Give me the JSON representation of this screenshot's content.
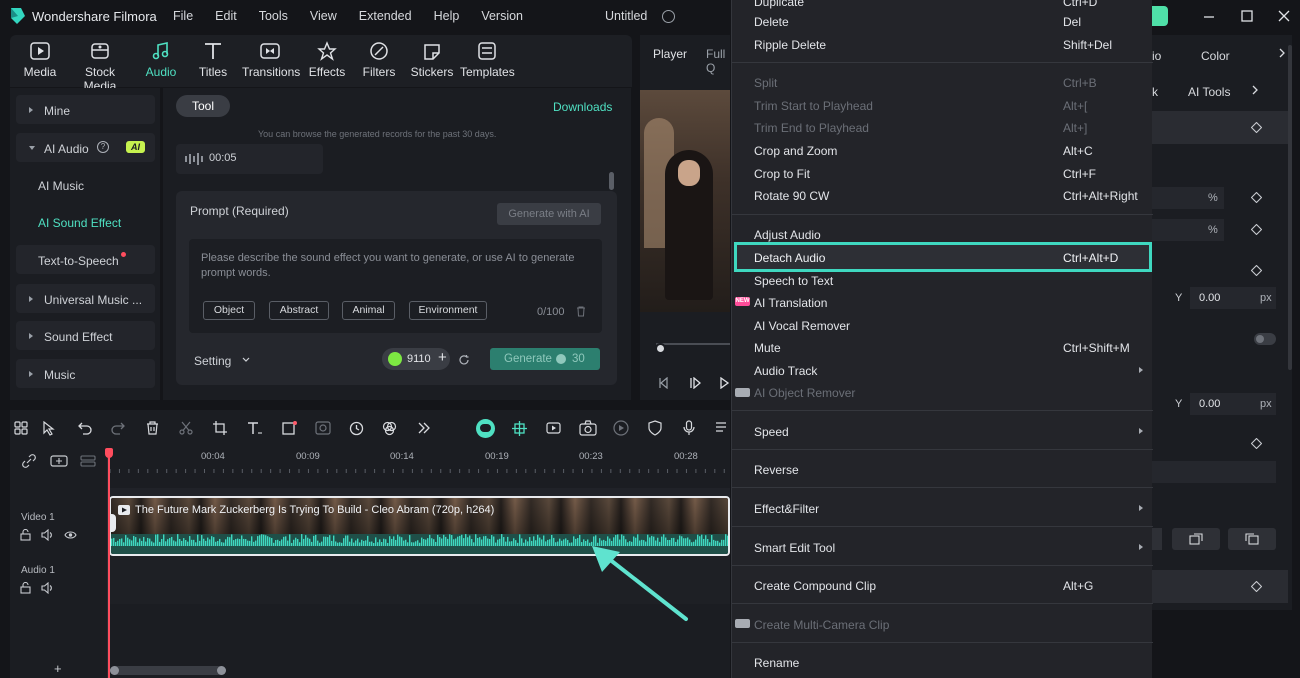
{
  "app": {
    "name": "Wondershare Filmora",
    "menu": [
      "File",
      "Edit",
      "Tools",
      "View",
      "Extended",
      "Help",
      "Version"
    ],
    "document_title": "Untitled"
  },
  "toolbar": {
    "tabs": [
      "Media",
      "Stock Media",
      "Audio",
      "Titles",
      "Transitions",
      "Effects",
      "Filters",
      "Stickers",
      "Templates"
    ]
  },
  "sidebar": {
    "mine": "Mine",
    "ai_audio": "AI Audio",
    "ai_badge": "AI",
    "ai_music": "AI Music",
    "ai_sound_effect": "AI Sound Effect",
    "tts": "Text-to-Speech",
    "universal_music": "Universal Music ...",
    "sound_effect": "Sound Effect",
    "music": "Music"
  },
  "ai_panel": {
    "tab": "Tool",
    "downloads": "Downloads",
    "records_note": "You can browse the generated records for the past 30 days.",
    "record_time": "00:05",
    "prompt_label": "Prompt (Required)",
    "generate_with_ai": "Generate with AI",
    "placeholder": "Please describe the sound effect you want to generate, or use AI to generate prompt words.",
    "chips": [
      "Object",
      "Abstract",
      "Animal",
      "Environment"
    ],
    "counter": "0/100",
    "setting": "Setting",
    "credits": "9110",
    "generate": "Generate",
    "generate_cost": "30"
  },
  "player": {
    "tab_player": "Player",
    "tab_full": "Full Q"
  },
  "timeline": {
    "ruler": [
      "00:04",
      "00:09",
      "00:14",
      "00:19",
      "00:23",
      "00:28"
    ],
    "video_track": "Video 1",
    "audio_track": "Audio 1",
    "clip_title": "The Future Mark Zuckerberg Is Trying To Build - Cleo Abram (720p, h264)"
  },
  "right_panel": {
    "tab_audio_partial": "io",
    "tab_color": "Color",
    "ai_tools": "AI Tools",
    "tab_partial": "k",
    "percent1": "%",
    "percent2": "%",
    "y_label_1": "Y",
    "y_value_1": "0.00",
    "unit_1": "px",
    "y_label_2": "Y",
    "y_value_2": "0.00",
    "unit_2": "px"
  },
  "context_menu": {
    "items": [
      {
        "label": "Duplicate",
        "shortcut": "Ctrl+D",
        "disabled": false
      },
      {
        "label": "Delete",
        "shortcut": "Del",
        "disabled": false
      },
      {
        "label": "Ripple Delete",
        "shortcut": "Shift+Del",
        "disabled": false
      },
      {
        "label": "Split",
        "shortcut": "Ctrl+B",
        "disabled": true
      },
      {
        "label": "Trim Start to Playhead",
        "shortcut": "Alt+[",
        "disabled": true
      },
      {
        "label": "Trim End to Playhead",
        "shortcut": "Alt+]",
        "disabled": true
      },
      {
        "label": "Crop and Zoom",
        "shortcut": "Alt+C",
        "disabled": false
      },
      {
        "label": "Crop to Fit",
        "shortcut": "Ctrl+F",
        "disabled": false
      },
      {
        "label": "Rotate 90 CW",
        "shortcut": "Ctrl+Alt+Right",
        "disabled": false
      },
      {
        "label": "Adjust Audio",
        "shortcut": "",
        "disabled": false
      },
      {
        "label": "Detach Audio",
        "shortcut": "Ctrl+Alt+D",
        "disabled": false
      },
      {
        "label": "Speech to Text",
        "shortcut": "",
        "disabled": false
      },
      {
        "label": "AI Translation",
        "shortcut": "",
        "disabled": false
      },
      {
        "label": "AI Vocal Remover",
        "shortcut": "",
        "disabled": false
      },
      {
        "label": "Mute",
        "shortcut": "Ctrl+Shift+M",
        "disabled": false
      },
      {
        "label": "Audio Track",
        "shortcut": "",
        "disabled": false
      },
      {
        "label": "AI Object Remover",
        "shortcut": "",
        "disabled": true
      },
      {
        "label": "Speed",
        "shortcut": "",
        "disabled": false
      },
      {
        "label": "Reverse",
        "shortcut": "",
        "disabled": false
      },
      {
        "label": "Effect&Filter",
        "shortcut": "",
        "disabled": false
      },
      {
        "label": "Smart Edit Tool",
        "shortcut": "",
        "disabled": false
      },
      {
        "label": "Create Compound Clip",
        "shortcut": "Alt+G",
        "disabled": false
      },
      {
        "label": "Create Multi-Camera Clip",
        "shortcut": "",
        "disabled": true
      },
      {
        "label": "Rename",
        "shortcut": "",
        "disabled": false
      }
    ],
    "new_badge": "NEW"
  },
  "colors": {
    "accent": "#4fe0c2",
    "highlight_border": "#3fd8c0",
    "background": "#141519"
  }
}
